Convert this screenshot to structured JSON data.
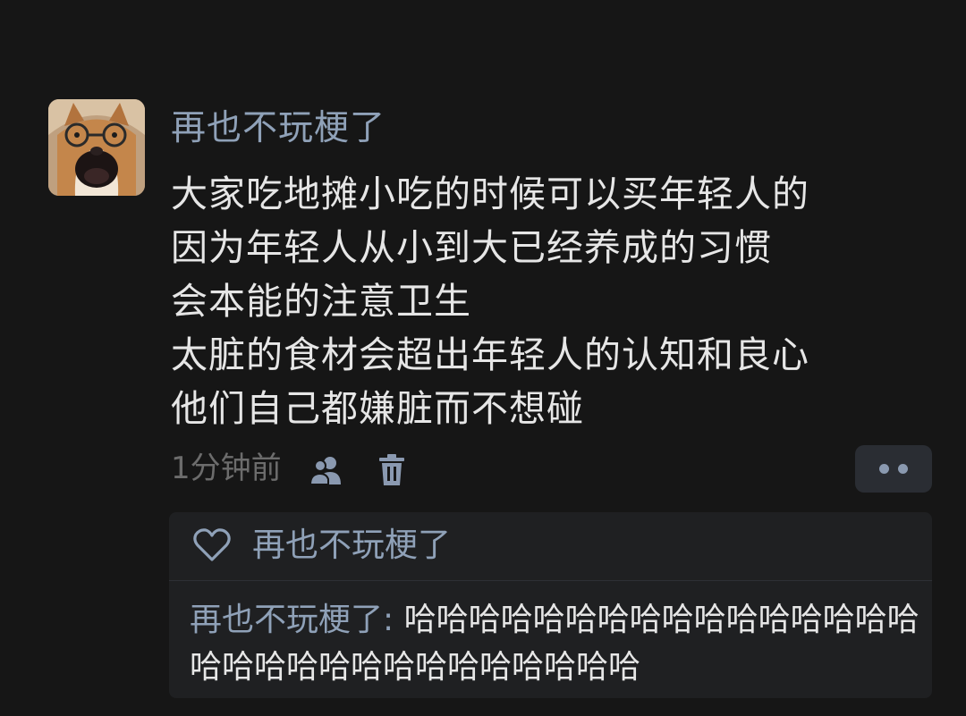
{
  "post": {
    "username": "再也不玩梗了",
    "content_lines": [
      "大家吃地摊小吃的时候可以买年轻人的",
      "因为年轻人从小到大已经养成的习惯",
      "会本能的注意卫生",
      "太脏的食材会超出年轻人的认知和良心",
      "他们自己都嫌脏而不想碰"
    ],
    "time": "1分钟前",
    "icons": {
      "visibility": "people-icon",
      "delete": "trash-icon",
      "more": "more-dots-icon",
      "like": "heart-outline-icon"
    }
  },
  "likes": {
    "names": "再也不玩梗了"
  },
  "reply": {
    "author": "再也不玩梗了",
    "separator": ": ",
    "text": "哈哈哈哈哈哈哈哈哈哈哈哈哈哈哈哈哈哈哈哈哈哈哈哈哈哈哈哈哈哈"
  },
  "colors": {
    "background": "#161616",
    "name_blue": "#8fa1b8",
    "body_text": "#e6e6e6",
    "muted": "#6c6c6c",
    "reply_bg": "#1f2022",
    "button_bg": "#2a2d33"
  }
}
